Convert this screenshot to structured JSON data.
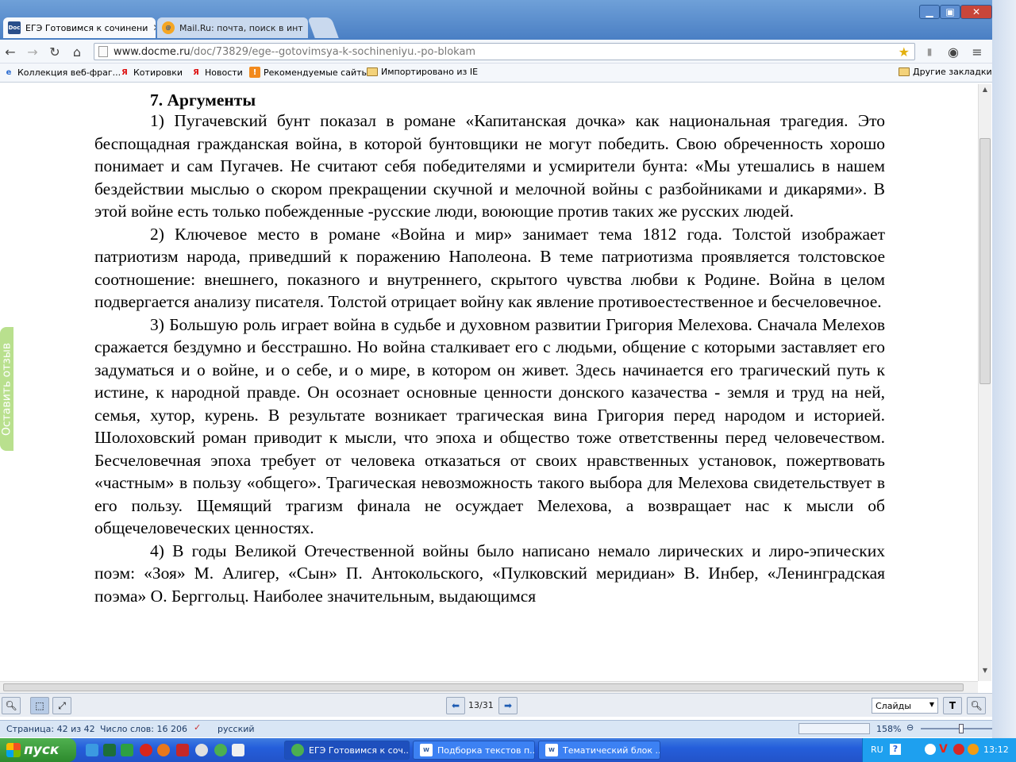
{
  "browser": {
    "tabs": [
      {
        "label": "ЕГЭ Готовимся к сочинени",
        "favicon": "docme-icon",
        "active": true
      },
      {
        "label": "Mail.Ru: почта, поиск в инт",
        "favicon": "mailru-icon",
        "active": false
      }
    ],
    "url_domain": "www.docme.ru",
    "url_path": "/doc/73829/ege--gotovimsya-k-sochineniyu.-po-blokam",
    "bookmarks": [
      {
        "label": "Коллекция веб-фраг...",
        "icon": "ie-icon"
      },
      {
        "label": "Котировки",
        "icon": "yandex-icon"
      },
      {
        "label": "Новости",
        "icon": "yandex-icon"
      },
      {
        "label": "Рекомендуемые сайты",
        "icon": "recommended-icon"
      },
      {
        "label": "Импортировано из IE",
        "icon": "folder-icon"
      }
    ],
    "other_bookmarks": "Другие закладки"
  },
  "document": {
    "heading": "7. Аргументы",
    "paragraphs": [
      "1) Пугачевский бунт показал в романе «Капитанская дочка» как национальная трагедия. Это беспощадная гражданская война, в которой бунтовщики не могут победить. Свою обреченность хорошо понимает и сам Пугачев. Не считают себя победителями и усмирители бунта: «Мы утешались в нашем бездействии мыслью о скором прекращении скучной и мелочной войны с разбойниками и дикарями». В этой войне есть только побежденные -русские люди, воюющие против таких же русских людей.",
      "2) Ключевое место в романе «Война и мир» занимает тема 1812 года. Толстой изображает патриотизм народа, приведший к поражению Наполеона. В теме патриотизма проявляется толстовское соотношение: внешнего, показного и внутреннего, скрытого чувства любви к Родине. Война в целом подвергается анализу писателя. Толстой отрицает войну как явление противоестественное и бесчеловечное.",
      "3) Большую роль играет война в судьбе и духовном развитии Григория Мелехова. Сначала Мелехов сражается бездумно и бесстрашно. Но война сталкивает его с людьми, общение с которыми заставляет его задуматься и о войне, и о себе, и о мире, в котором он живет. Здесь начинается его трагический путь к истине, к народной правде. Он осознает основные ценности донского казачества - земля и труд на ней, семья, хутор, курень. В результате возникает трагическая вина Григория перед народом и историей. Шолоховский роман приводит к мысли, что эпоха и общество тоже ответственны перед человечеством. Бесчеловечная эпоха требует от человека отказаться от своих нравственных установок, пожертвовать «частным» в пользу «общего». Трагическая невозможность такого выбора для Мелехова свидетельствует в его пользу. Щемящий трагизм финала не осуждает Мелехова, а возвращает нас к мысли об общечеловеческих ценностях.",
      "4) В годы Великой Отечественной войны было написано немало лирических и лиро-эпических поэм: «Зоя» М. Алигер, «Сын» П. Антокольского, «Пулковский меридиан» В. Инбер, «Ленинградская поэма» О. Берггольц. Наиболее значительным, выдающимся"
    ]
  },
  "feedback_tab": "Оставить отзыв",
  "viewer": {
    "page_counter": "13/31",
    "view_mode": "Слайды"
  },
  "status_bar": {
    "page": "Страница: 42 из 42",
    "words": "Число слов: 16 206",
    "language": "русский",
    "zoom": "158%"
  },
  "taskbar": {
    "start_label": "пуск",
    "tasks": [
      {
        "label": "ЕГЭ Готовимся к соч...",
        "icon": "chrome-icon"
      },
      {
        "label": "Подборка текстов п...",
        "icon": "word-icon"
      },
      {
        "label": "Тематический блок ...",
        "icon": "word-icon"
      }
    ],
    "lang": "RU",
    "clock": "13:12"
  },
  "colors": {
    "taskbar": "#245edb",
    "start": "#2d8a2d",
    "feedback": "#b9e08e",
    "chrome_frame": "#4a7fc4"
  }
}
